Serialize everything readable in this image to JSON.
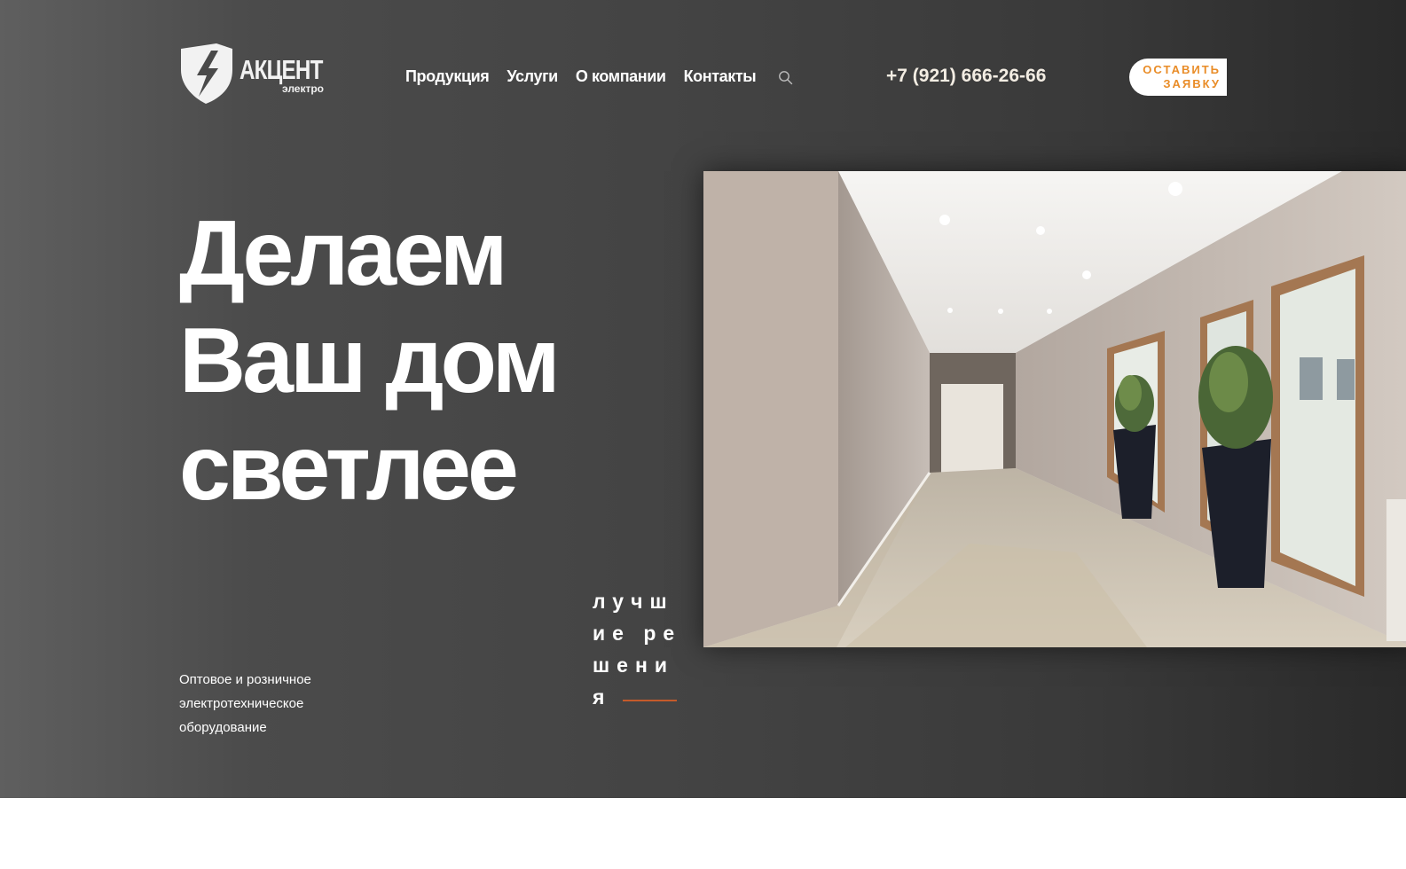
{
  "logo": {
    "icon": "shield-lightning-icon",
    "name": "АКЦЕНТ",
    "sub": "электро"
  },
  "nav": {
    "items": [
      {
        "label": "Продукция"
      },
      {
        "label": "Услуги"
      },
      {
        "label": "О компании"
      },
      {
        "label": "Контакты"
      }
    ],
    "search_icon": "search-icon"
  },
  "phone": "+7 (921) 666-26-66",
  "cta": {
    "line1": "ОСТАВИТЬ",
    "line2": "ЗАЯВКУ"
  },
  "hero": {
    "headline": [
      "Делаем",
      "Ваш дом",
      "светлее"
    ],
    "subtitle": "Оптовое и розничное электротехническое оборудование",
    "tagline": "лучшие решения",
    "image": "hallway-interior-photo"
  },
  "colors": {
    "accent": "#e98c27",
    "tagline_rule": "#c55a2a",
    "hero_bg": "#434343",
    "text": "#ffffff"
  }
}
